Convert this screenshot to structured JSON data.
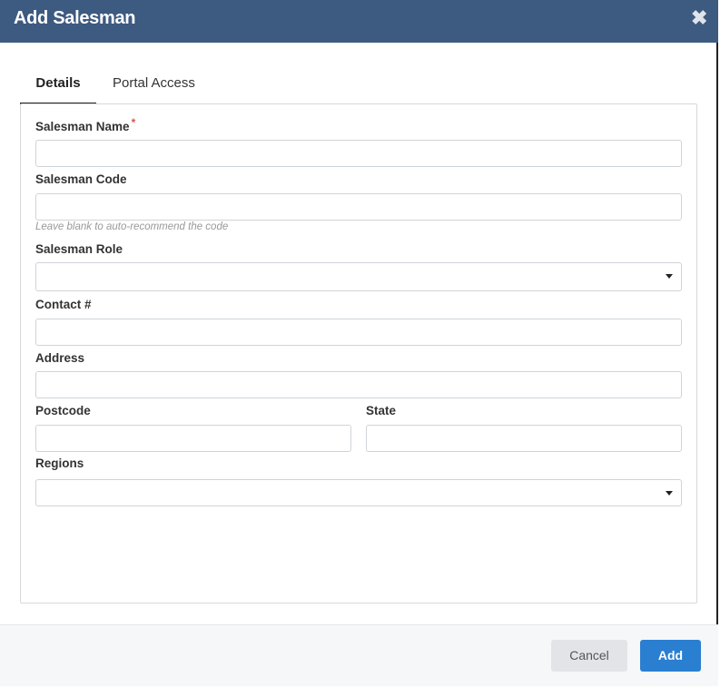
{
  "dialog": {
    "title": "Add Salesman",
    "close_icon": "close-icon"
  },
  "tabs": [
    {
      "label": "Details",
      "active": true
    },
    {
      "label": "Portal Access",
      "active": false
    }
  ],
  "form": {
    "salesman_name": {
      "label": "Salesman Name",
      "required_mark": "*",
      "value": ""
    },
    "salesman_code": {
      "label": "Salesman Code",
      "value": "",
      "hint": "Leave blank to auto-recommend the code"
    },
    "salesman_role": {
      "label": "Salesman Role",
      "value": ""
    },
    "contact": {
      "label": "Contact #",
      "value": ""
    },
    "address": {
      "label": "Address",
      "value": ""
    },
    "postcode": {
      "label": "Postcode",
      "value": ""
    },
    "state": {
      "label": "State",
      "value": ""
    },
    "regions": {
      "label": "Regions",
      "value": ""
    }
  },
  "footer": {
    "cancel_label": "Cancel",
    "add_label": "Add"
  },
  "colors": {
    "header_bg": "#3d5a80",
    "primary": "#2a7fd1",
    "required": "#d9534f"
  }
}
